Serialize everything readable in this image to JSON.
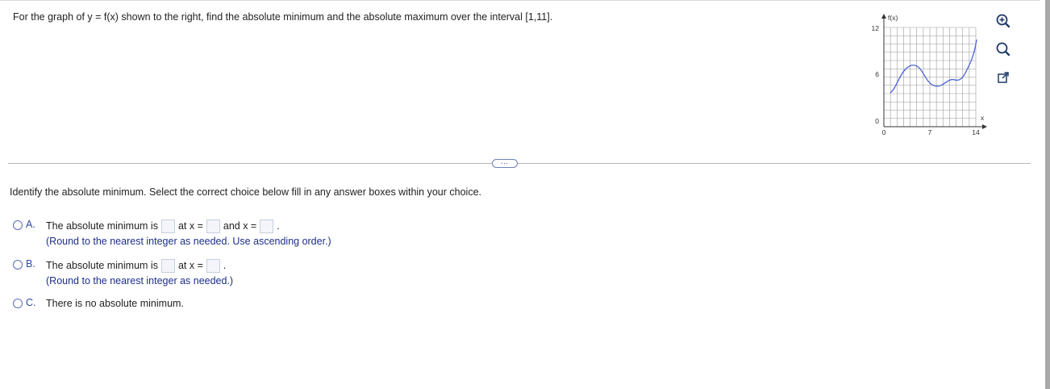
{
  "question": "For the graph of y = f(x) shown to the right, find the absolute minimum and the absolute maximum over the interval [1,11].",
  "graph": {
    "y_axis_label": "f(x)",
    "x_axis_label": "x",
    "y_ticks": [
      "12",
      "6",
      "0"
    ],
    "x_ticks": [
      "0",
      "7",
      "14"
    ],
    "curve_color": "#4b63d6"
  },
  "tools": {
    "zoom_in": "zoom-in-icon",
    "zoom_out": "zoom-out-icon",
    "popout": "external-link-icon"
  },
  "more_button": "…",
  "instruction": "Identify the absolute minimum. Select the correct choice below fill in any answer boxes within your choice.",
  "choices": {
    "a": {
      "letter": "A.",
      "t1": "The absolute minimum is",
      "t2": "at x =",
      "t3": "and x =",
      "t4": ".",
      "note": "(Round to the nearest integer as needed. Use ascending order.)"
    },
    "b": {
      "letter": "B.",
      "t1": "The absolute minimum is",
      "t2": "at x =",
      "t3": ".",
      "note": "(Round to the nearest integer as needed.)"
    },
    "c": {
      "letter": "C.",
      "text": "There is no absolute minimum."
    }
  }
}
